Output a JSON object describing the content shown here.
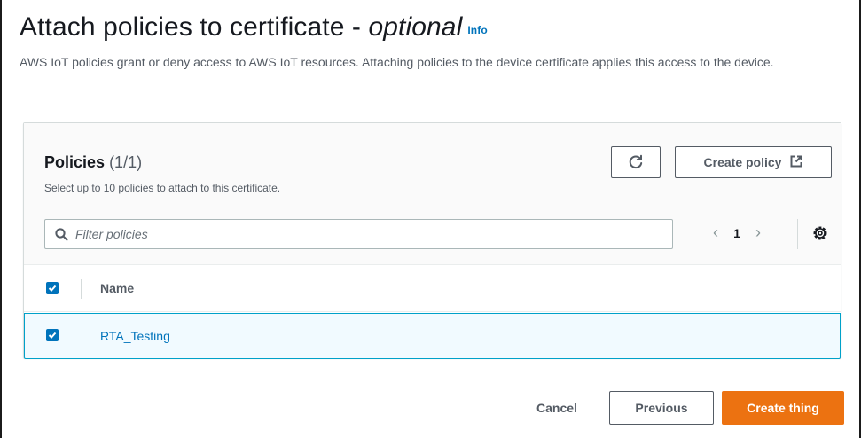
{
  "header": {
    "title": "Attach policies to certificate - ",
    "title_italic": "optional",
    "info_link": "Info",
    "description": "AWS IoT policies grant or deny access to AWS IoT resources. Attaching policies to the device certificate applies this access to the device."
  },
  "policies": {
    "title": "Policies",
    "count": "(1/1)",
    "subtitle": "Select up to 10 policies to attach to this certificate.",
    "refresh_icon": "refresh-icon",
    "create_policy_label": "Create policy",
    "external_icon": "external-link-icon",
    "filter_placeholder": "Filter policies",
    "page": "1",
    "table": {
      "columns": [
        "Name"
      ],
      "rows": [
        {
          "name": "RTA_Testing",
          "selected": true
        }
      ]
    }
  },
  "footer": {
    "cancel_label": "Cancel",
    "previous_label": "Previous",
    "create_label": "Create thing"
  },
  "colors": {
    "primary": "#ec7211",
    "link": "#0073bb",
    "selected_row_bg": "#f1faff",
    "selected_row_border": "#00a1c9"
  }
}
